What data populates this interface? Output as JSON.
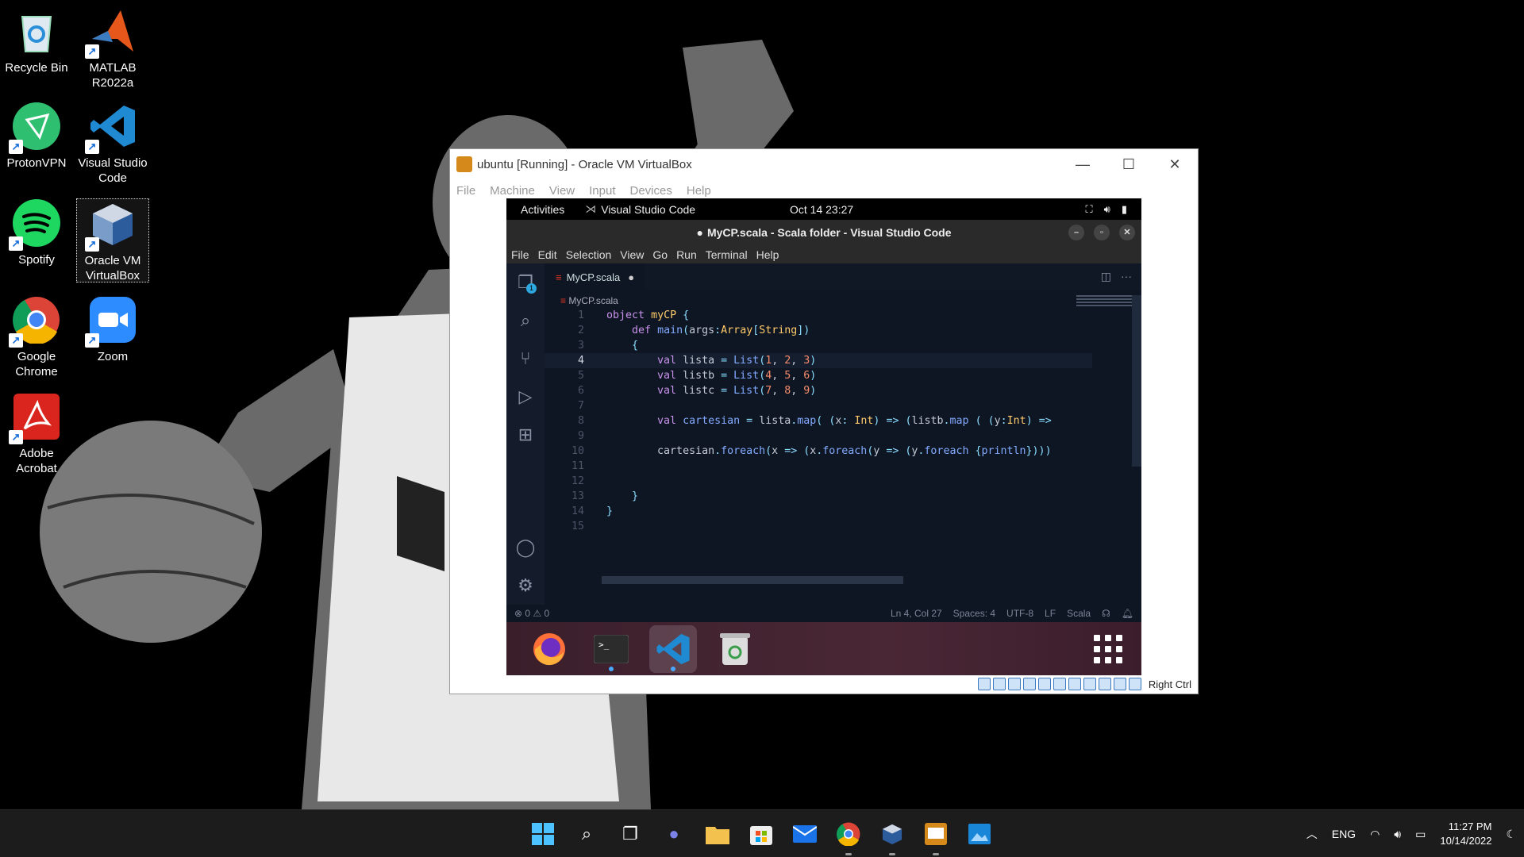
{
  "desktop": {
    "icons": [
      {
        "label": "Recycle Bin",
        "icon": "recycle-bin-icon"
      },
      {
        "label": "MATLAB R2022a",
        "icon": "matlab-icon"
      },
      {
        "label": "ProtonVPN",
        "icon": "protonvpn-icon"
      },
      {
        "label": "Visual Studio Code",
        "icon": "vscode-icon"
      },
      {
        "label": "Spotify",
        "icon": "spotify-icon"
      },
      {
        "label": "Oracle VM VirtualBox",
        "icon": "virtualbox-icon"
      },
      {
        "label": "Google Chrome",
        "icon": "chrome-icon"
      },
      {
        "label": "Zoom",
        "icon": "zoom-icon"
      },
      {
        "label": "Adobe Acrobat",
        "icon": "acrobat-icon"
      }
    ]
  },
  "vbox": {
    "title": "ubuntu [Running] - Oracle VM VirtualBox",
    "menu": [
      "File",
      "Machine",
      "View",
      "Input",
      "Devices",
      "Help"
    ],
    "host_key": "Right Ctrl"
  },
  "gnome": {
    "activities": "Activities",
    "app_name": "Visual Studio Code",
    "clock": "Oct 14  23:27"
  },
  "vscode": {
    "title": "MyCP.scala - Scala folder - Visual Studio Code",
    "menu": [
      "File",
      "Edit",
      "Selection",
      "View",
      "Go",
      "Run",
      "Terminal",
      "Help"
    ],
    "tab_label": "MyCP.scala",
    "breadcrumb": "MyCP.scala",
    "explorer_badge": "1",
    "current_line": 4,
    "status": {
      "problems": "⊗ 0 ⚠ 0",
      "position": "Ln 4, Col 27",
      "spaces": "Spaces: 4",
      "encoding": "UTF-8",
      "eol": "LF",
      "language": "Scala"
    }
  },
  "taskbar": {
    "lang": "ENG",
    "time": "11:27 PM",
    "date": "10/14/2022"
  },
  "colors": {
    "editor_bg": "#0f1623",
    "keyword": "#c792ea",
    "type": "#ffcb6b",
    "function": "#82aaff",
    "number": "#f78c6c",
    "vscode_blue": "#1f8ad2"
  }
}
